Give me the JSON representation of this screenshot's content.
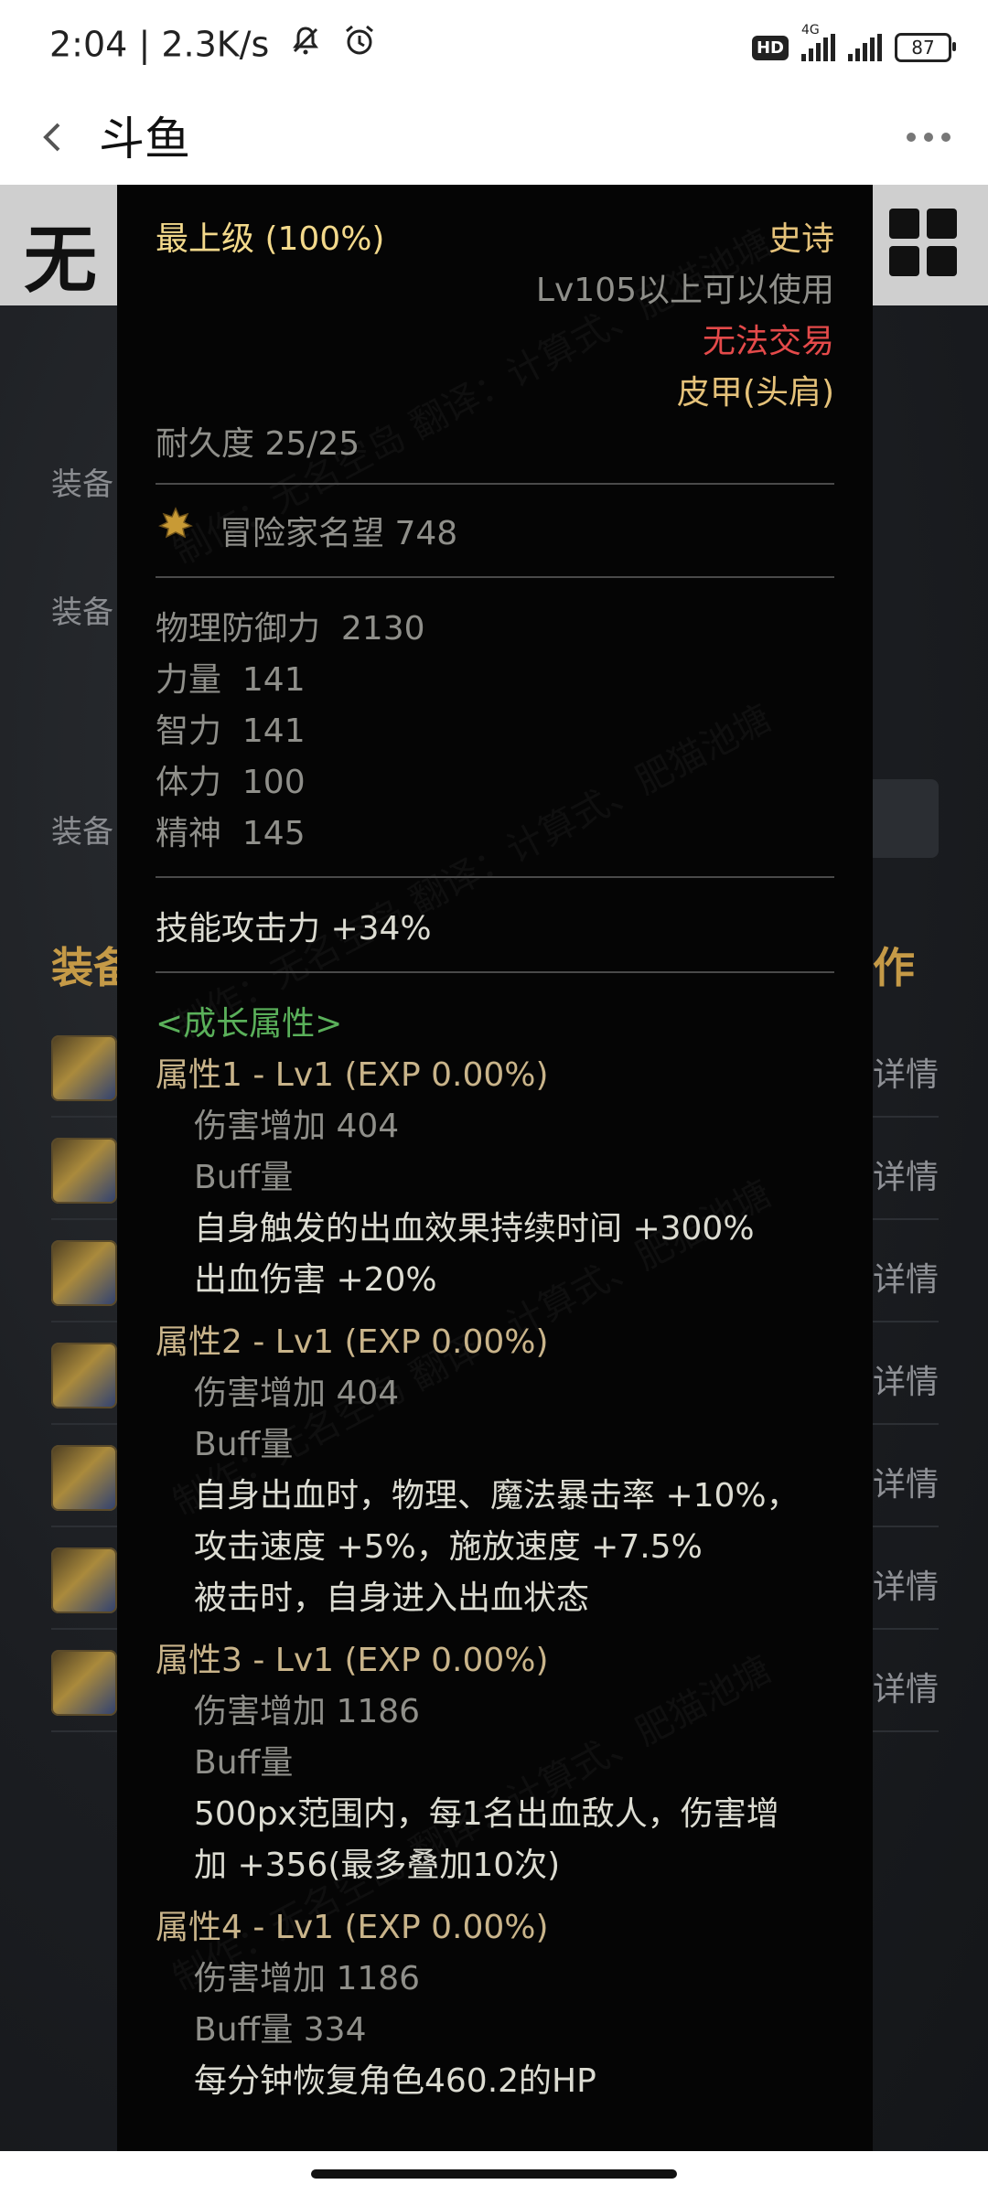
{
  "status_bar": {
    "time": "2:04",
    "net_speed": "2.3K/s",
    "hd": "HD",
    "net_type": "4G",
    "battery": "87"
  },
  "title_bar": {
    "title": "斗鱼"
  },
  "background_page": {
    "logo_char": "无",
    "labels": [
      "装备",
      "装备",
      "装备"
    ],
    "section_left": "装备",
    "section_right": "作",
    "detail_link": "详情"
  },
  "tooltip": {
    "grade": "最上级 (100%)",
    "rarity": "史诗",
    "level_req": "Lv105以上可以使用",
    "trade": "无法交易",
    "type": "皮甲(头肩)",
    "durability": "耐久度 25/25",
    "reputation": "冒险家名望 748",
    "stats": [
      {
        "name": "物理防御力",
        "value": "2130"
      },
      {
        "name": "力量",
        "value": "141"
      },
      {
        "name": "智力",
        "value": "141"
      },
      {
        "name": "体力",
        "value": "100"
      },
      {
        "name": "精神",
        "value": "145"
      }
    ],
    "skill_attack": "技能攻击力  +34%",
    "growth_header": "<成长属性>",
    "attr1": {
      "title": "属性1 - Lv1 (EXP 0.00%)",
      "damage": "伤害增加   404",
      "buff": "Buff量",
      "desc1": "自身触发的出血效果持续时间 +300%",
      "desc2": "出血伤害 +20%"
    },
    "attr2": {
      "title": "属性2 - Lv1 (EXP 0.00%)",
      "damage": "伤害增加   404",
      "buff": "Buff量",
      "desc1": "自身出血时，物理、魔法暴击率 +10%，",
      "desc2": "攻击速度 +5%，施放速度 +7.5%",
      "desc3": "被击时，自身进入出血状态"
    },
    "attr3": {
      "title": "属性3 - Lv1 (EXP 0.00%)",
      "damage": "伤害增加   1186",
      "buff": "Buff量",
      "desc1": "500px范围内，每1名出血敌人，伤害增",
      "desc2": "加 +356(最多叠加10次)"
    },
    "attr4": {
      "title": "属性4 - Lv1 (EXP 0.00%)",
      "damage": "伤害增加   1186",
      "buff": "Buff量   334",
      "desc1": "每分钟恢复角色460.2的HP"
    },
    "watermark": "制作：无名空岛 翻译：计算式、肥猫池塘"
  }
}
